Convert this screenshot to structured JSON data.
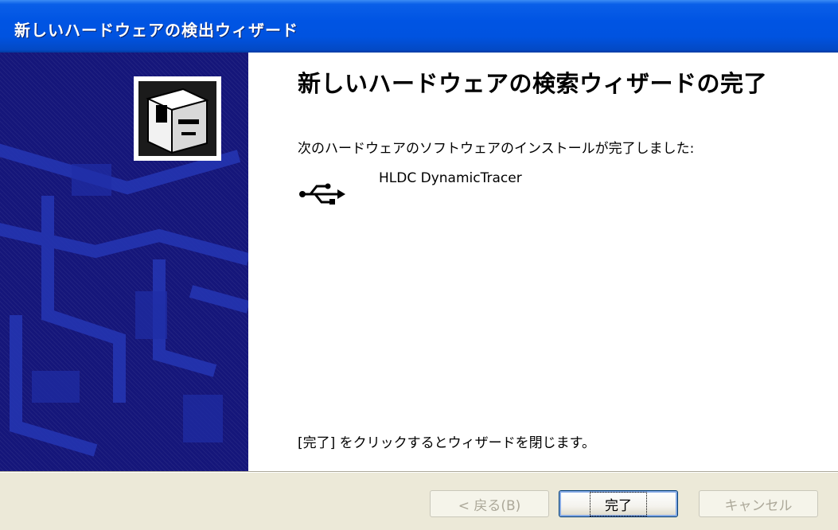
{
  "window": {
    "title": "新しいハードウェアの検出ウィザード"
  },
  "main": {
    "heading": "新しいハードウェアの検索ウィザードの完了",
    "message": "次のハードウェアのソフトウェアのインストールが完了しました:",
    "device": {
      "icon": "usb-icon",
      "name": "HLDC DynamicTracer"
    },
    "footer_message": "[完了] をクリックするとウィザードを閉じます。"
  },
  "side_panel": {
    "icon": "hardware-box-icon",
    "colors": {
      "background": "#15167a",
      "graphic": "#1e2fa8"
    }
  },
  "buttons": {
    "back": "< 戻る(B)",
    "finish": "完了",
    "cancel": "キャンセル"
  },
  "colors": {
    "titlebar": "#0054e3",
    "bottom_bar": "#ece9d8"
  }
}
